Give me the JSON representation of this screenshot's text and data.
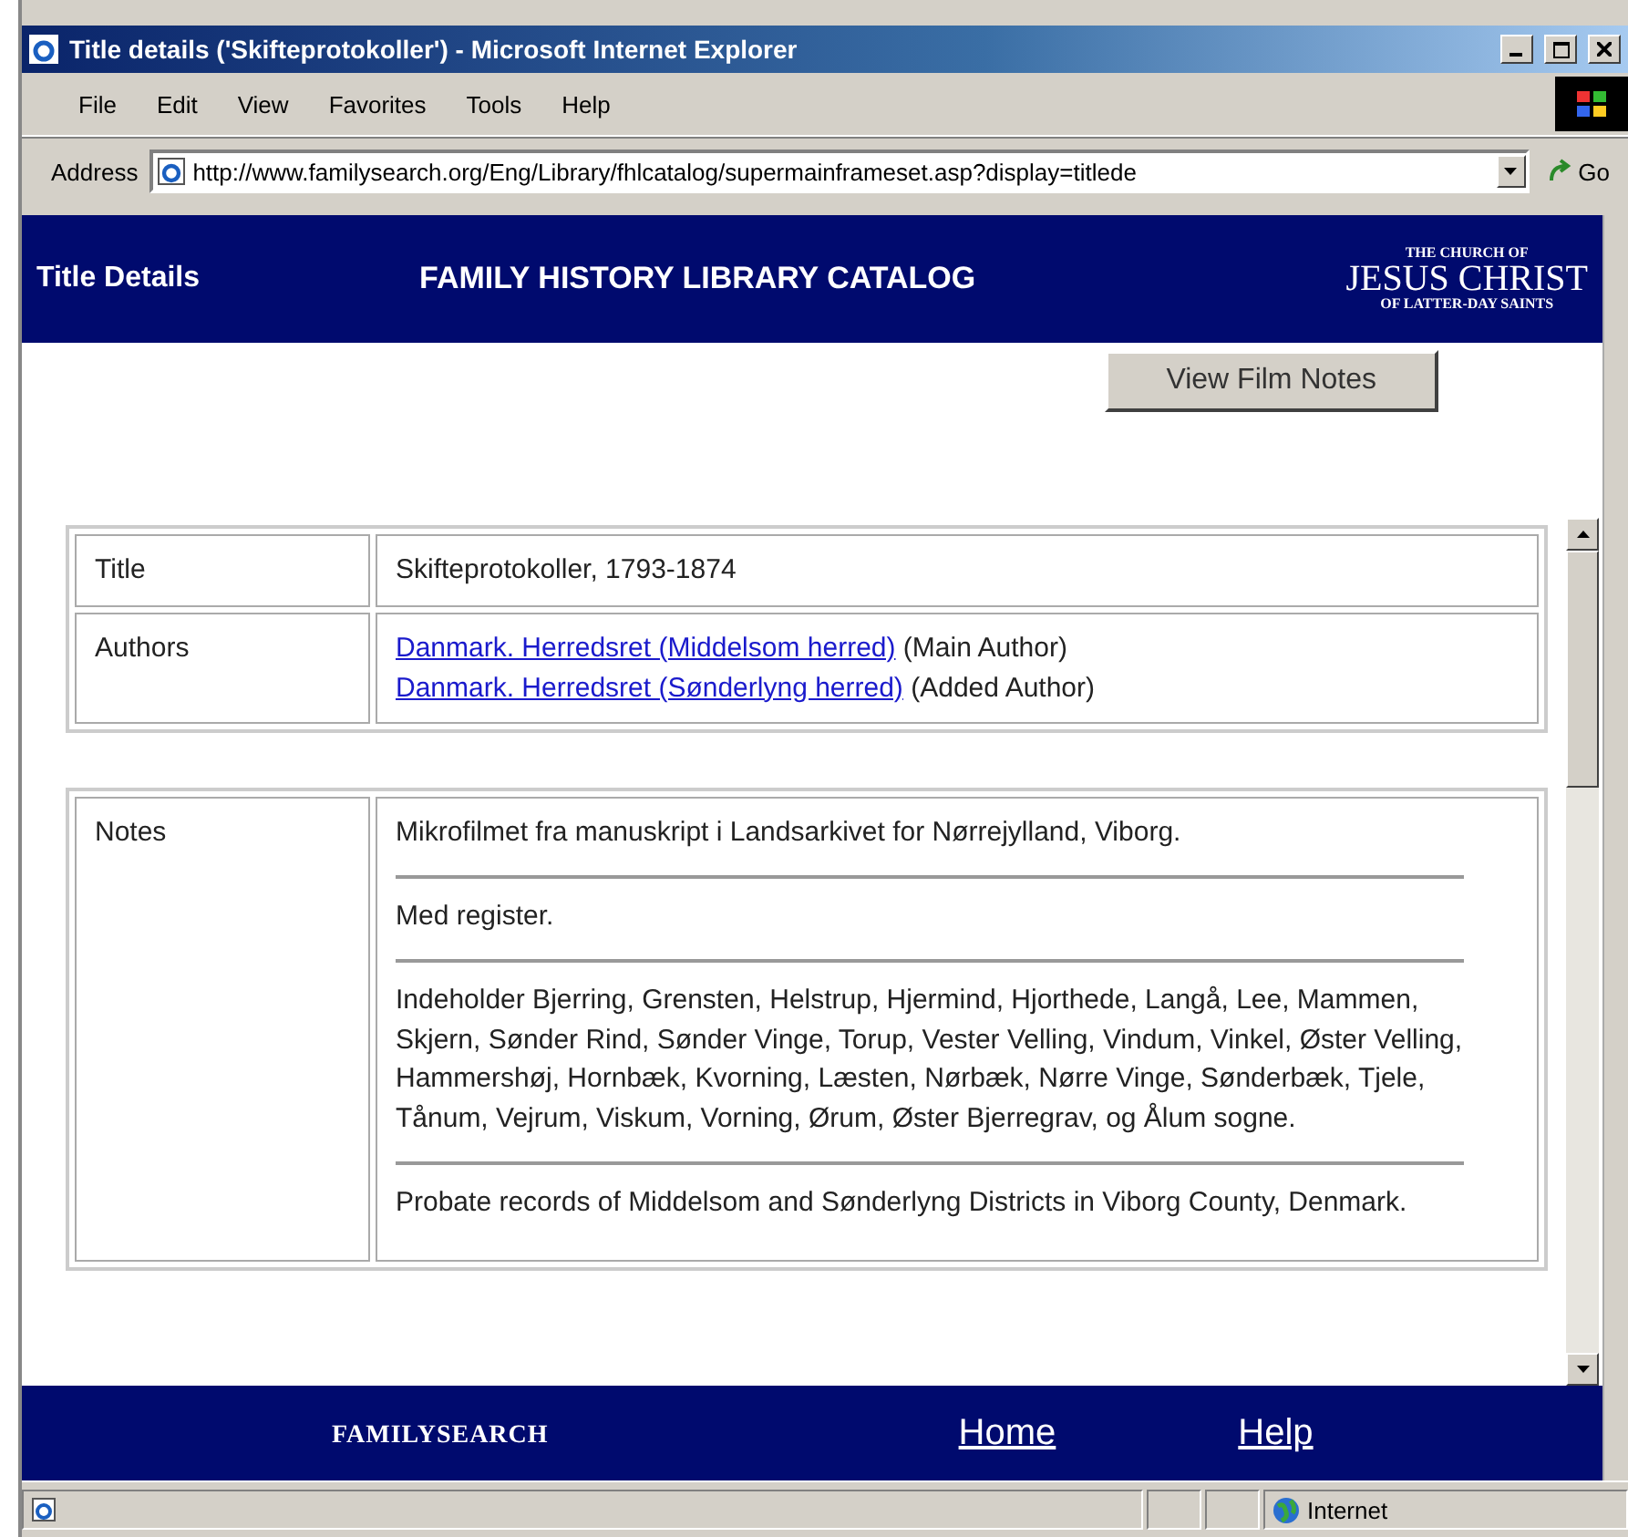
{
  "window": {
    "title": "Title details ('Skifteprotokoller') - Microsoft Internet Explorer"
  },
  "menu": [
    "File",
    "Edit",
    "View",
    "Favorites",
    "Tools",
    "Help"
  ],
  "address_bar": {
    "label": "Address",
    "value": "http://www.familysearch.org/Eng/Library/fhlcatalog/supermainframeset.asp?display=titlede",
    "go": "Go"
  },
  "header": {
    "page_title": "Title Details",
    "catalog_title": "FAMILY HISTORY LIBRARY CATALOG",
    "logo": {
      "top": "THE CHURCH OF",
      "main": "JESUS CHRIST",
      "bottom": "OF LATTER-DAY SAINTS"
    }
  },
  "view_button": "View Film Notes",
  "details": [
    {
      "label": "Title",
      "value": "Skifteprotokoller, 1793-1874"
    },
    {
      "label": "Authors",
      "authors": [
        {
          "name": "Danmark. Herredsret (Middelsom herred)",
          "role": "(Main Author)"
        },
        {
          "name": "Danmark. Herredsret (Sønderlyng herred)",
          "role": "(Added Author)"
        }
      ]
    }
  ],
  "notes": {
    "label": "Notes",
    "paragraphs": [
      "Mikrofilmet fra manuskript i Landsarkivet for Nørrejylland, Viborg.",
      "Med register.",
      "Indeholder Bjerring, Grensten, Helstrup, Hjermind, Hjorthede, Langå, Lee, Mammen, Skjern, Sønder Rind, Sønder Vinge, Torup, Vester Velling, Vindum, Vinkel, Øster Velling, Hammershøj, Hornbæk, Kvorning, Læsten, Nørbæk, Nørre Vinge, Sønderbæk, Tjele, Tånum, Vejrum, Viskum, Vorning, Ørum, Øster Bjerregrav, og Ålum sogne.",
      "Probate records of Middelsom and Sønderlyng Districts in Viborg County, Denmark."
    ]
  },
  "footer": {
    "logo": "FAMILYSEARCH",
    "links": [
      "Home",
      "Help"
    ]
  },
  "status_bar": {
    "zone": "Internet"
  }
}
